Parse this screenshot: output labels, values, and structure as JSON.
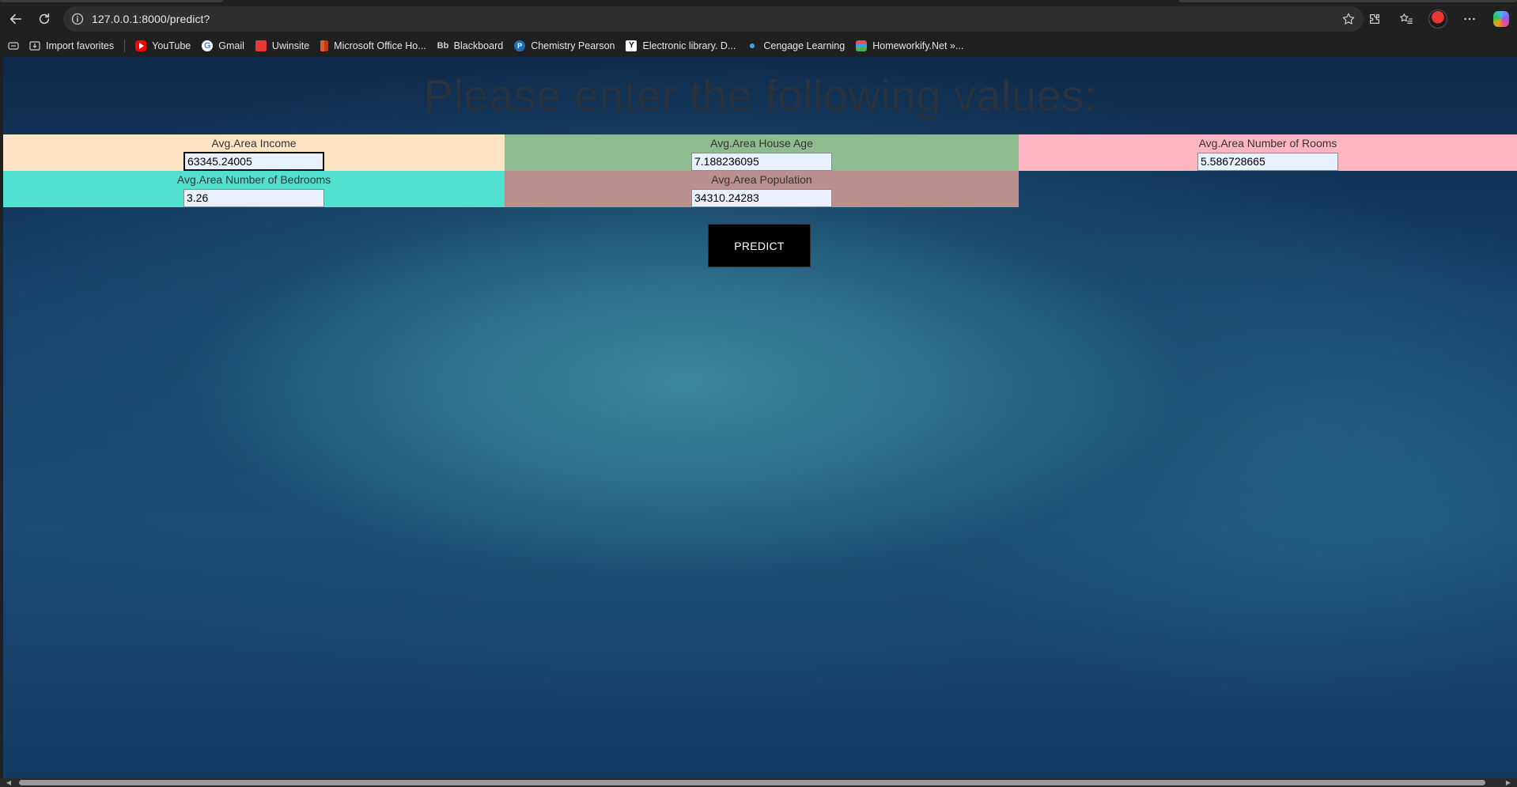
{
  "browser": {
    "url": "127.0.0.1:8000/predict?",
    "favorites": [
      {
        "label": "Import favorites",
        "icon": "import-icon",
        "color": "#cfcfcf"
      },
      {
        "label": "YouTube",
        "icon": "youtube-icon",
        "color": "#ff0000"
      },
      {
        "label": "Gmail",
        "icon": "google-icon",
        "color": "#ffffff"
      },
      {
        "label": "Uwinsite",
        "icon": "uwinsite-icon",
        "color": "#e53935"
      },
      {
        "label": "Microsoft Office Ho...",
        "icon": "office-icon",
        "color": "#e8542b"
      },
      {
        "label": "Blackboard",
        "icon": "blackboard-icon",
        "color": "#cfcfcf"
      },
      {
        "label": "Chemistry Pearson",
        "icon": "pearson-icon",
        "color": "#1f6fb5"
      },
      {
        "label": "Electronic library. D...",
        "icon": "library-icon",
        "color": "#ffffff"
      },
      {
        "label": "Cengage Learning",
        "icon": "cengage-icon",
        "color": "#3aa0e0"
      },
      {
        "label": "Homeworkify.Net »...",
        "icon": "homeworkify-icon",
        "color": "#e25555"
      }
    ]
  },
  "page": {
    "title": "Please enter the following values:",
    "fields": [
      {
        "label": "Avg.Area Income",
        "value": "63345.24005",
        "color": "#ffe4c4"
      },
      {
        "label": "Avg.Area House Age",
        "value": "7.188236095",
        "color": "#8fbc8f"
      },
      {
        "label": "Avg.Area Number of Rooms",
        "value": "5.586728665",
        "color": "#ffb6c1"
      },
      {
        "label": "Avg.Area Number of Bedrooms",
        "value": "3.26",
        "color": "#52e0d0"
      },
      {
        "label": "Avg.Area Population",
        "value": "34310.24283",
        "color": "#bc8f8f"
      }
    ],
    "submit_label": "PREDICT"
  }
}
